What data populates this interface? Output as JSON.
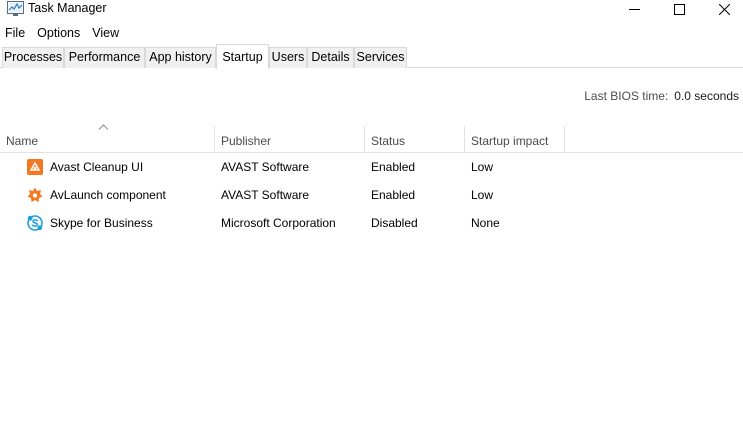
{
  "window": {
    "title": "Task Manager"
  },
  "menu": [
    "File",
    "Options",
    "View"
  ],
  "tabs": [
    {
      "label": "Processes",
      "active": false
    },
    {
      "label": "Performance",
      "active": false
    },
    {
      "label": "App history",
      "active": false
    },
    {
      "label": "Startup",
      "active": true
    },
    {
      "label": "Users",
      "active": false
    },
    {
      "label": "Details",
      "active": false
    },
    {
      "label": "Services",
      "active": false
    }
  ],
  "bios": {
    "label": "Last BIOS time:",
    "value": "0.0 seconds"
  },
  "columns": [
    "Name",
    "Publisher",
    "Status",
    "Startup impact"
  ],
  "sort": {
    "column": "Name",
    "direction": "ascending"
  },
  "rows": [
    {
      "icon": "avast-cleanup-icon",
      "name": "Avast Cleanup UI",
      "publisher": "AVAST Software",
      "status": "Enabled",
      "impact": "Low"
    },
    {
      "icon": "avast-icon",
      "name": "AvLaunch component",
      "publisher": "AVAST Software",
      "status": "Enabled",
      "impact": "Low"
    },
    {
      "icon": "skype-icon",
      "name": "Skype for Business",
      "publisher": "Microsoft Corporation",
      "status": "Disabled",
      "impact": "None"
    }
  ],
  "colors": {
    "avast_orange": "#f47820",
    "skype_blue": "#1ea0e0",
    "tab_border": "#d9d9d9",
    "header_text": "#4a4a4a"
  }
}
